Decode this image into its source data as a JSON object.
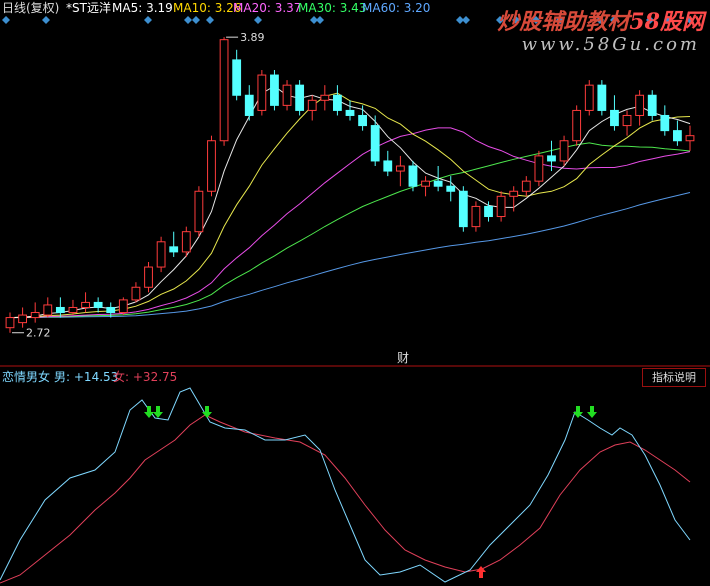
{
  "header": {
    "period": "日线(复权)",
    "stock": "*ST远洋",
    "ma": [
      {
        "label": "MA5:",
        "value": "3.19",
        "color": "#ffffff"
      },
      {
        "label": "MA10:",
        "value": "3.26",
        "color": "#ffd700"
      },
      {
        "label": "MA20:",
        "value": "3.37",
        "color": "#ff66ff"
      },
      {
        "label": "MA30:",
        "value": "3.43",
        "color": "#33ff66"
      },
      {
        "label": "MA60:",
        "value": "3.20",
        "color": "#5fa8ff"
      }
    ]
  },
  "watermark": {
    "title_a": "炒股辅助教材",
    "title_b": "58股网",
    "url": "www.58Gu.com"
  },
  "colors": {
    "up": "#ff3c3c",
    "down": "#54ffff",
    "ma5": "#ffffff",
    "ma10": "#ffff55",
    "ma20": "#ff55ff",
    "ma30": "#55ff55",
    "ma60": "#5fa8ff",
    "men": "#7fd8ff",
    "women": "#e0405a",
    "divider": "#b01010",
    "diamond": "#3d8fd0"
  },
  "chart_data": [
    {
      "type": "candlestick",
      "title": "*ST远洋",
      "ylim": [
        2.62,
        3.95
      ],
      "annotations": {
        "high": "3.89",
        "low": "2.72",
        "event": "财"
      },
      "candles": [
        [
          2.74,
          2.8,
          2.72,
          2.78
        ],
        [
          2.76,
          2.82,
          2.74,
          2.79
        ],
        [
          2.78,
          2.84,
          2.76,
          2.8
        ],
        [
          2.79,
          2.86,
          2.78,
          2.83
        ],
        [
          2.82,
          2.86,
          2.78,
          2.8
        ],
        [
          2.8,
          2.85,
          2.79,
          2.82
        ],
        [
          2.82,
          2.88,
          2.8,
          2.84
        ],
        [
          2.84,
          2.86,
          2.8,
          2.82
        ],
        [
          2.82,
          2.84,
          2.78,
          2.8
        ],
        [
          2.8,
          2.86,
          2.79,
          2.85
        ],
        [
          2.85,
          2.92,
          2.84,
          2.9
        ],
        [
          2.9,
          3.0,
          2.88,
          2.98
        ],
        [
          2.98,
          3.1,
          2.96,
          3.08
        ],
        [
          3.06,
          3.12,
          3.02,
          3.04
        ],
        [
          3.04,
          3.14,
          3.02,
          3.12
        ],
        [
          3.12,
          3.3,
          3.1,
          3.28
        ],
        [
          3.28,
          3.5,
          3.26,
          3.48
        ],
        [
          3.48,
          3.89,
          3.46,
          3.88
        ],
        [
          3.8,
          3.84,
          3.64,
          3.66
        ],
        [
          3.66,
          3.7,
          3.56,
          3.58
        ],
        [
          3.6,
          3.76,
          3.58,
          3.74
        ],
        [
          3.74,
          3.76,
          3.6,
          3.62
        ],
        [
          3.62,
          3.72,
          3.6,
          3.7
        ],
        [
          3.7,
          3.72,
          3.58,
          3.6
        ],
        [
          3.6,
          3.66,
          3.56,
          3.64
        ],
        [
          3.64,
          3.7,
          3.6,
          3.66
        ],
        [
          3.66,
          3.7,
          3.58,
          3.6
        ],
        [
          3.6,
          3.64,
          3.56,
          3.58
        ],
        [
          3.58,
          3.62,
          3.52,
          3.54
        ],
        [
          3.54,
          3.58,
          3.38,
          3.4
        ],
        [
          3.4,
          3.44,
          3.34,
          3.36
        ],
        [
          3.36,
          3.42,
          3.3,
          3.38
        ],
        [
          3.38,
          3.4,
          3.28,
          3.3
        ],
        [
          3.3,
          3.34,
          3.26,
          3.32
        ],
        [
          3.32,
          3.38,
          3.28,
          3.3
        ],
        [
          3.3,
          3.34,
          3.24,
          3.28
        ],
        [
          3.28,
          3.3,
          3.12,
          3.14
        ],
        [
          3.14,
          3.24,
          3.12,
          3.22
        ],
        [
          3.22,
          3.24,
          3.16,
          3.18
        ],
        [
          3.18,
          3.28,
          3.16,
          3.26
        ],
        [
          3.26,
          3.3,
          3.2,
          3.28
        ],
        [
          3.28,
          3.34,
          3.26,
          3.32
        ],
        [
          3.32,
          3.44,
          3.3,
          3.42
        ],
        [
          3.42,
          3.48,
          3.36,
          3.4
        ],
        [
          3.4,
          3.5,
          3.38,
          3.48
        ],
        [
          3.48,
          3.62,
          3.46,
          3.6
        ],
        [
          3.6,
          3.72,
          3.58,
          3.7
        ],
        [
          3.7,
          3.72,
          3.58,
          3.6
        ],
        [
          3.6,
          3.66,
          3.52,
          3.54
        ],
        [
          3.54,
          3.6,
          3.5,
          3.58
        ],
        [
          3.58,
          3.68,
          3.54,
          3.66
        ],
        [
          3.66,
          3.68,
          3.56,
          3.58
        ],
        [
          3.58,
          3.62,
          3.5,
          3.52
        ],
        [
          3.52,
          3.56,
          3.46,
          3.48
        ],
        [
          3.48,
          3.54,
          3.44,
          3.5
        ]
      ]
    },
    {
      "type": "line",
      "title": "恋情男女",
      "series": [
        {
          "name": "男",
          "value": "+14.53"
        },
        {
          "name": "女",
          "value": "+32.75"
        }
      ],
      "ylim": [
        -5,
        100
      ]
    }
  ],
  "indicator_button": "指标说明"
}
